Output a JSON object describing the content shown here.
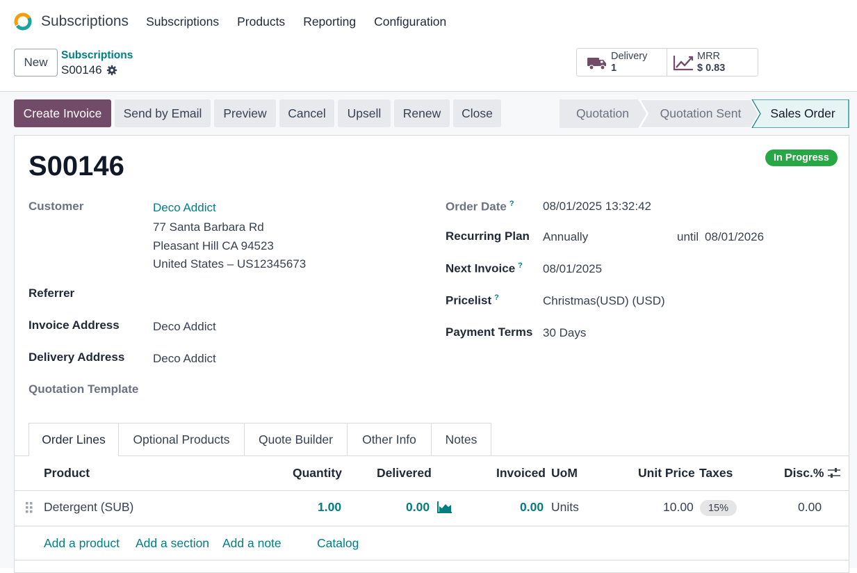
{
  "app": {
    "name": "Subscriptions",
    "nav": [
      "Subscriptions",
      "Products",
      "Reporting",
      "Configuration"
    ]
  },
  "control": {
    "new_label": "New",
    "breadcrumb_parent": "Subscriptions",
    "breadcrumb_current": "S00146"
  },
  "smart_buttons": {
    "delivery_label": "Delivery",
    "delivery_value": "1",
    "mrr_label": "MRR",
    "mrr_value": "$ 0.83"
  },
  "actions": [
    "Create Invoice",
    "Send by Email",
    "Preview",
    "Cancel",
    "Upsell",
    "Renew",
    "Close"
  ],
  "status": {
    "stages": [
      "Quotation",
      "Quotation Sent",
      "Sales Order"
    ],
    "active": "Sales Order",
    "badge": "In Progress"
  },
  "form": {
    "name": "S00146",
    "customer_label": "Customer",
    "customer_name": "Deco Addict",
    "customer_address": [
      "77 Santa Barbara Rd",
      "Pleasant Hill CA 94523",
      "United States – US12345673"
    ],
    "referrer_label": "Referrer",
    "invoice_address_label": "Invoice Address",
    "invoice_address": "Deco Addict",
    "delivery_address_label": "Delivery Address",
    "delivery_address": "Deco Addict",
    "quotation_template_label": "Quotation Template",
    "order_date_label": "Order Date",
    "order_date": "08/01/2025 13:32:42",
    "recurring_plan_label": "Recurring Plan",
    "recurring_plan": "Annually",
    "until_label": "until",
    "until_date": "08/01/2026",
    "next_invoice_label": "Next Invoice",
    "next_invoice": "08/01/2025",
    "pricelist_label": "Pricelist",
    "pricelist": "Christmas(USD) (USD)",
    "payment_terms_label": "Payment Terms",
    "payment_terms": "30 Days",
    "help_mark": "?"
  },
  "tabs": [
    "Order Lines",
    "Optional Products",
    "Quote Builder",
    "Other Info",
    "Notes"
  ],
  "order_lines": {
    "columns": [
      "Product",
      "Quantity",
      "Delivered",
      "Invoiced",
      "UoM",
      "Unit Price",
      "Taxes",
      "Disc.%"
    ],
    "rows": [
      {
        "product": "Detergent (SUB)",
        "quantity": "1.00",
        "delivered": "0.00",
        "invoiced": "0.00",
        "uom": "Units",
        "unit_price": "10.00",
        "taxes": "15%",
        "discount": "0.00"
      }
    ],
    "add_links": [
      "Add a product",
      "Add a section",
      "Add a note",
      "Catalog"
    ]
  },
  "colors": {
    "primary": "#714b67",
    "link": "#017e84",
    "badge": "#28a745"
  }
}
